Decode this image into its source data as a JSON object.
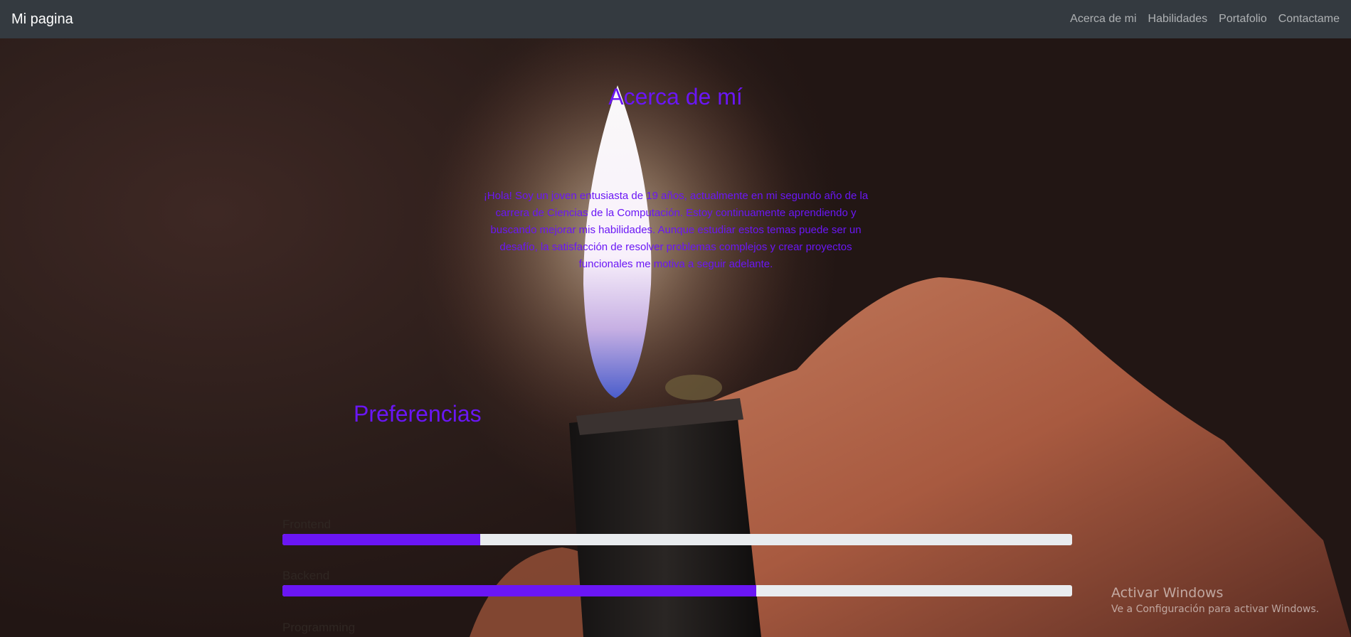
{
  "navbar": {
    "brand": "Mi pagina",
    "links": [
      "Acerca de mi",
      "Habilidades",
      "Portafolio",
      "Contactame"
    ]
  },
  "about": {
    "title": "Acerca de mí",
    "text": "¡Hola! Soy un joven entusiasta de 19 años, actualmente en mi segundo año de la carrera de Ciencias de la Computación. Estoy continuamente aprendiendo y buscando mejorar mis habilidades. Aunque estudiar estos temas puede ser un desafío, la satisfacción de resolver problemas complejos y crear proyectos funcionales me motiva a seguir adelante."
  },
  "preferences": {
    "title": "Preferencias",
    "skills": [
      {
        "label": "Frontend",
        "percent": 25
      },
      {
        "label": "Backend",
        "percent": 60
      },
      {
        "label": "Programming",
        "percent": null
      }
    ]
  },
  "watermark": {
    "title": "Activar Windows",
    "subtitle": "Ve a Configuración para activar Windows."
  },
  "colors": {
    "accent": "#6a16f5",
    "navbar": "#343a40",
    "bar_track": "#e9ecef"
  }
}
